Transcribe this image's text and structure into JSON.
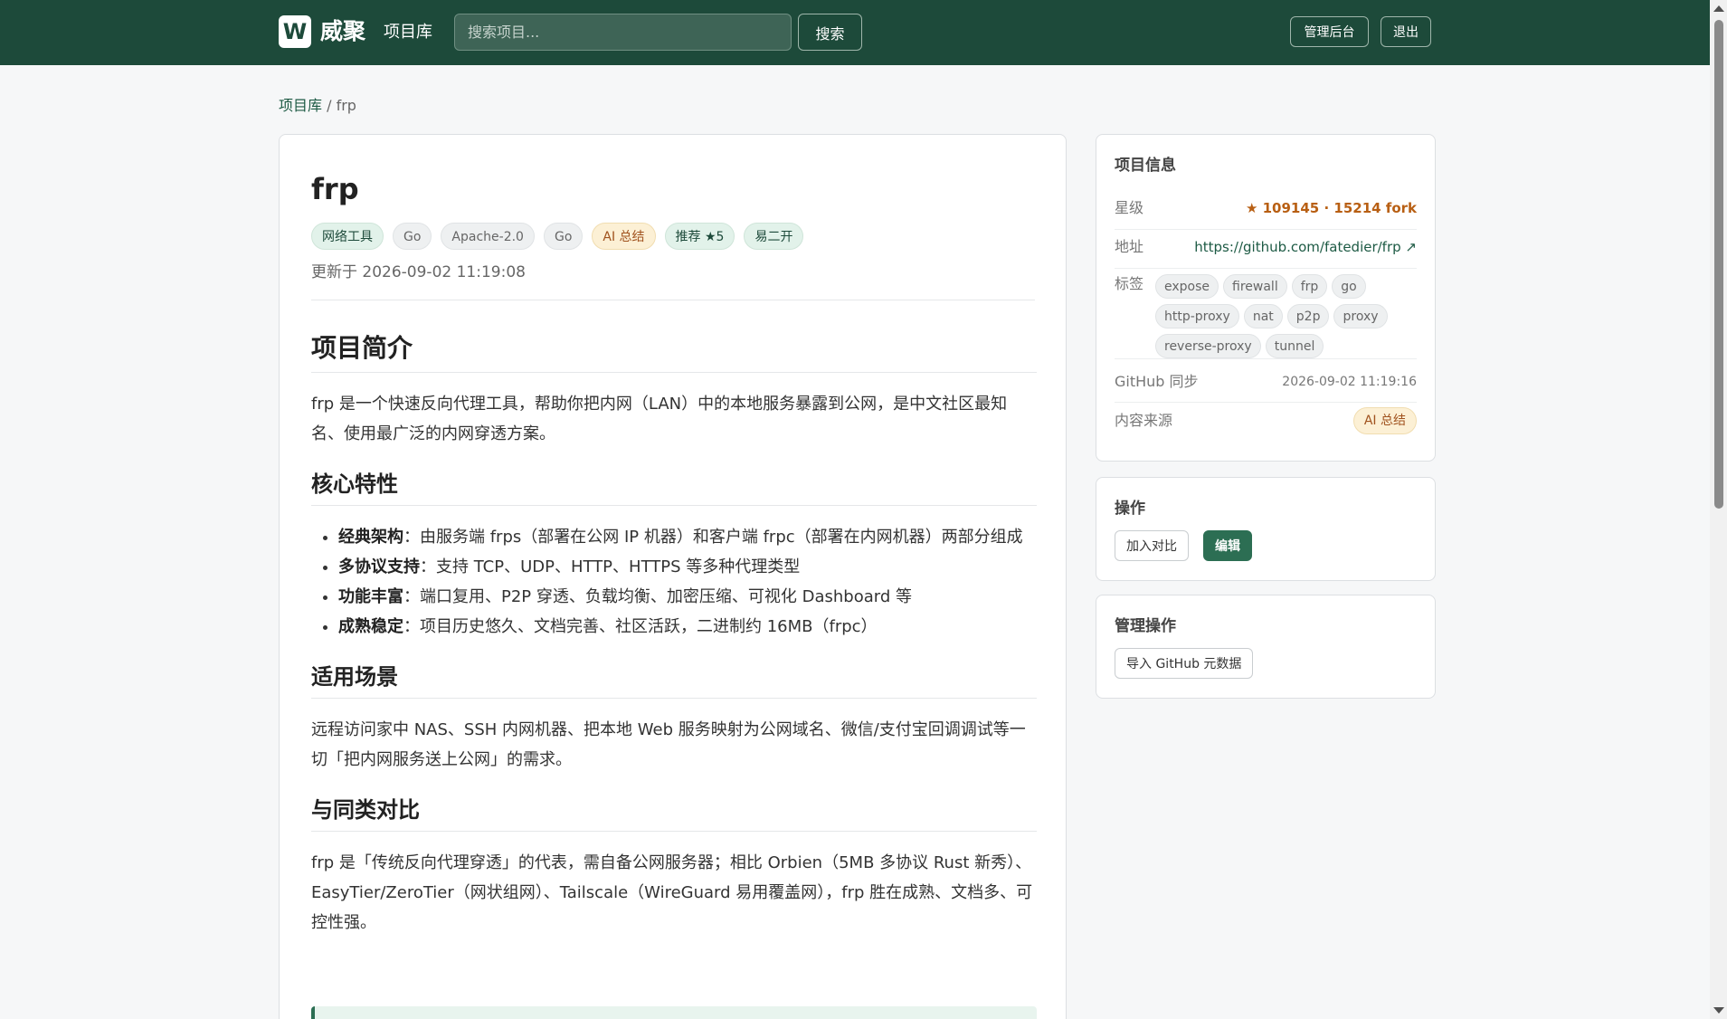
{
  "header": {
    "logo_letter": "W",
    "brand": "威聚",
    "nav_link": "项目库",
    "search_placeholder": "搜索项目...",
    "search_button": "搜索",
    "admin_button": "管理后台",
    "logout_button": "退出"
  },
  "breadcrumb": {
    "root": "项目库",
    "separator": " / ",
    "current": "frp"
  },
  "project": {
    "title": "frp",
    "tags": [
      {
        "label": "网络工具",
        "style": "green"
      },
      {
        "label": "Go",
        "style": "gray"
      },
      {
        "label": "Apache-2.0",
        "style": "gray"
      },
      {
        "label": "Go",
        "style": "gray"
      },
      {
        "label": "AI 总结",
        "style": "gold"
      },
      {
        "label": "推荐 ★5",
        "style": "green"
      },
      {
        "label": "易二开",
        "style": "green"
      }
    ],
    "updated": "更新于 2026-09-02 11:19:08"
  },
  "content": {
    "h_intro": "项目简介",
    "p_intro": "frp 是一个快速反向代理工具，帮助你把内网（LAN）中的本地服务暴露到公网，是中文社区最知名、使用最广泛的内网穿透方案。",
    "h_features": "核心特性",
    "features": [
      {
        "bold": "经典架构",
        "text": "：由服务端 frps（部署在公网 IP 机器）和客户端 frpc（部署在内网机器）两部分组成"
      },
      {
        "bold": "多协议支持",
        "text": "：支持 TCP、UDP、HTTP、HTTPS 等多种代理类型"
      },
      {
        "bold": "功能丰富",
        "text": "：端口复用、P2P 穿透、负载均衡、加密压缩、可视化 Dashboard 等"
      },
      {
        "bold": "成熟稳定",
        "text": "：项目历史悠久、文档完善、社区活跃，二进制约 16MB（frpc）"
      }
    ],
    "h_scenarios": "适用场景",
    "p_scenarios": "远程访问家中 NAS、SSH 内网机器、把本地 Web 服务映射为公网域名、微信/支付宝回调调试等一切「把内网服务送上公网」的需求。",
    "h_compare": "与同类对比",
    "p_compare": "frp 是「传统反向代理穿透」的代表，需自备公网服务器；相比 Orbien（5MB 多协议 Rust 新秀）、EasyTier/ZeroTier（网状组网）、Tailscale（WireGuard 易用覆盖网），frp 胜在成熟、文档多、可控性强。"
  },
  "info": {
    "title": "项目信息",
    "stars_label": "星级",
    "stars_value": "★ 109145 · 15214 fork",
    "url_label": "地址",
    "url_value": "https://github.com/fatedier/frp ↗",
    "topics_label": "标签",
    "topics": [
      "expose",
      "firewall",
      "frp",
      "go",
      "http-proxy",
      "nat",
      "p2p",
      "proxy",
      "reverse-proxy",
      "tunnel"
    ],
    "sync_label": "GitHub 同步",
    "sync_value": "2026-09-02 11:19:16",
    "source_label": "内容来源",
    "source_value": "AI 总结"
  },
  "actions": {
    "title": "操作",
    "compare_button": "加入对比",
    "edit_button": "编辑"
  },
  "admin": {
    "title": "管理操作",
    "import_button": "导入 GitHub 元数据"
  },
  "colors": {
    "header_bg": "#1d4a3a",
    "primary": "#2c6e53",
    "star": "#b85f13"
  }
}
